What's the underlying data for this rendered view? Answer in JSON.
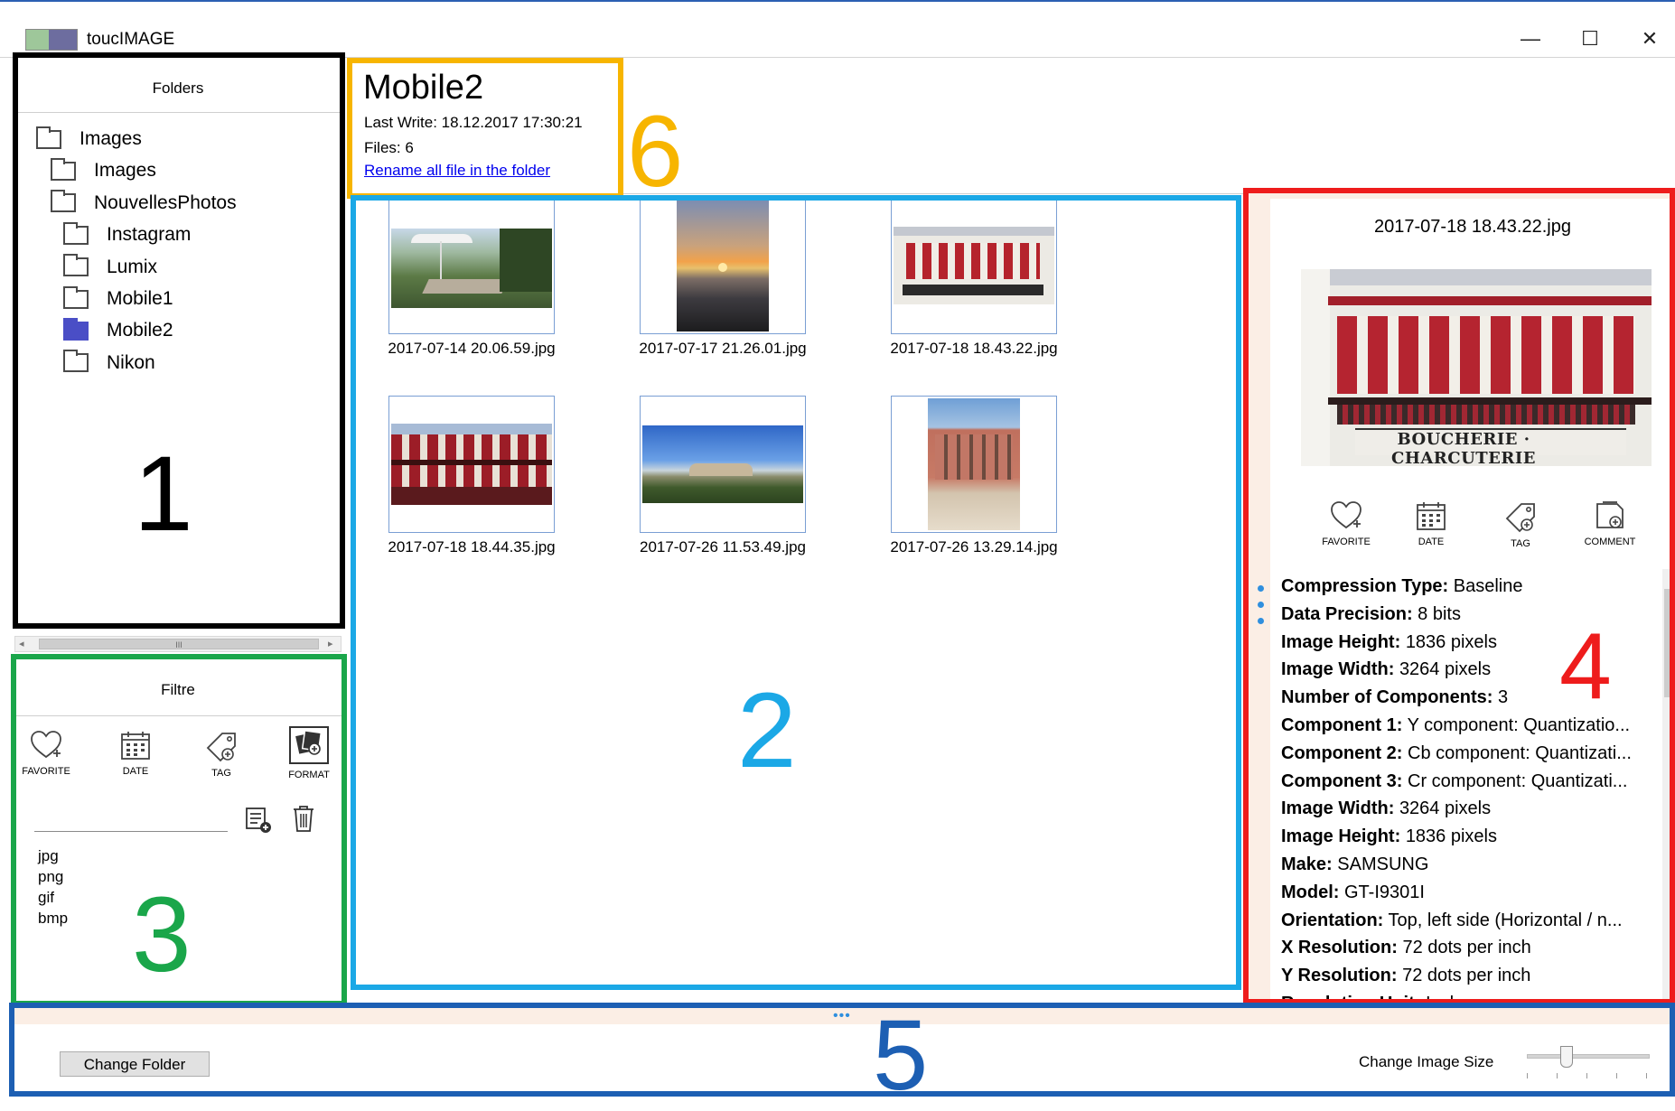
{
  "app": {
    "title": "toucIMAGE",
    "icon_text": "toucIMAGE"
  },
  "window_controls": {
    "minimize": "—",
    "maximize": "☐",
    "close": "✕"
  },
  "folders": {
    "header": "Folders",
    "items": [
      {
        "label": "Images",
        "level": 0,
        "selected": false
      },
      {
        "label": "Images",
        "level": 1,
        "selected": false
      },
      {
        "label": "NouvellesPhotos",
        "level": 1,
        "selected": false
      },
      {
        "label": "Instagram",
        "level": 2,
        "selected": false
      },
      {
        "label": "Lumix",
        "level": 2,
        "selected": false
      },
      {
        "label": "Mobile1",
        "level": 2,
        "selected": false
      },
      {
        "label": "Mobile2",
        "level": 2,
        "selected": true
      },
      {
        "label": "Nikon",
        "level": 2,
        "selected": false
      }
    ],
    "scroll_thumb": "III"
  },
  "filter": {
    "header": "Filtre",
    "buttons": [
      {
        "label": "FAVORITE",
        "icon": "heart-plus-icon"
      },
      {
        "label": "DATE",
        "icon": "calendar-icon"
      },
      {
        "label": "TAG",
        "icon": "tag-icon"
      },
      {
        "label": "FORMAT",
        "icon": "format-icon",
        "active": true
      }
    ],
    "formats": [
      "jpg",
      "png",
      "gif",
      "bmp"
    ]
  },
  "folder_info": {
    "name": "Mobile2",
    "last_write": "Last Write: 18.12.2017 17:30:21",
    "files": "Files: 6",
    "rename_link": "Rename all file in the folder"
  },
  "gallery": {
    "images": [
      {
        "filename": "2017-07-14 20.06.59.jpg"
      },
      {
        "filename": "2017-07-17 21.26.01.jpg"
      },
      {
        "filename": "2017-07-18 18.43.22.jpg"
      },
      {
        "filename": "2017-07-18 18.44.35.jpg"
      },
      {
        "filename": "2017-07-26 11.53.49.jpg"
      },
      {
        "filename": "2017-07-26 13.29.14.jpg"
      }
    ]
  },
  "details": {
    "filename": "2017-07-18 18.43.22.jpg",
    "image_sign": "BOUCHERIE · CHARCUTERIE",
    "actions": [
      {
        "label": "FAVORITE",
        "icon": "heart-plus-icon"
      },
      {
        "label": "DATE",
        "icon": "calendar-icon"
      },
      {
        "label": "TAG",
        "icon": "tag-icon"
      },
      {
        "label": "COMMENT",
        "icon": "comment-icon"
      }
    ],
    "metadata": [
      {
        "key": "Compression Type:",
        "value": "Baseline"
      },
      {
        "key": "Data Precision:",
        "value": "8 bits"
      },
      {
        "key": "Image Height:",
        "value": "1836 pixels"
      },
      {
        "key": "Image Width:",
        "value": "3264 pixels"
      },
      {
        "key": "Number of Components:",
        "value": "3"
      },
      {
        "key": "Component 1:",
        "value": "Y component: Quantizatio..."
      },
      {
        "key": "Component 2:",
        "value": "Cb component: Quantizati..."
      },
      {
        "key": "Component 3:",
        "value": "Cr component: Quantizati..."
      },
      {
        "key": "Image Width:",
        "value": "3264 pixels"
      },
      {
        "key": "Image Height:",
        "value": "1836 pixels"
      },
      {
        "key": "Make:",
        "value": "SAMSUNG"
      },
      {
        "key": "Model:",
        "value": "GT-I9301I"
      },
      {
        "key": "Orientation:",
        "value": "Top, left side (Horizontal / n..."
      },
      {
        "key": "X Resolution:",
        "value": "72 dots per inch"
      },
      {
        "key": "Y Resolution:",
        "value": "72 dots per inch"
      },
      {
        "key": "Resolution Unit:",
        "value": "Inch"
      }
    ]
  },
  "footer": {
    "change_folder": "Change Folder",
    "change_size_label": "Change Image Size",
    "slider_value": 0.3,
    "grip": "•••"
  },
  "annotations": {
    "labels": [
      "1",
      "2",
      "3",
      "4",
      "5",
      "6"
    ],
    "colors": {
      "1": "#000000",
      "2": "#1ba8e6",
      "3": "#1aa64a",
      "4": "#ee1c1c",
      "5": "#1d5fb3",
      "6": "#f7b500"
    }
  },
  "colors": {
    "accent": "#4a4ec6",
    "link": "#0000ee",
    "panel_bg": "#fbeee5",
    "border_blue": "#2b5fb3"
  }
}
